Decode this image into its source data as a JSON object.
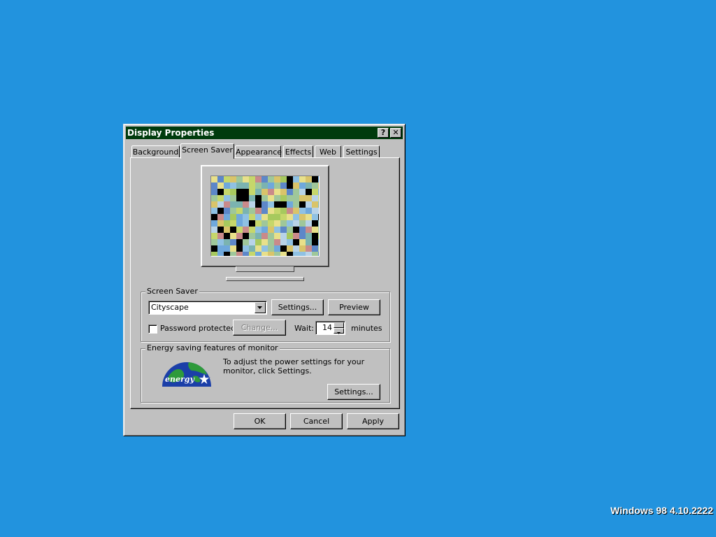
{
  "window": {
    "title": "Display Properties",
    "help_label": "?",
    "close_label": "✕"
  },
  "tabs": [
    {
      "label": "Background"
    },
    {
      "label": "Screen Saver",
      "active": true
    },
    {
      "label": "Appearance"
    },
    {
      "label": "Effects"
    },
    {
      "label": "Web"
    },
    {
      "label": "Settings"
    }
  ],
  "screen_saver": {
    "group_label": "Screen Saver",
    "selected": "Cityscape",
    "settings_label": "Settings...",
    "preview_label": "Preview",
    "password_label": "Password protected",
    "password_checked": false,
    "change_label": "Change...",
    "wait_label": "Wait:",
    "wait_value": "14",
    "minutes_label": "minutes"
  },
  "energy": {
    "group_label": "Energy saving features of monitor",
    "description": "To adjust the power settings for your monitor, click Settings.",
    "settings_label": "Settings...",
    "logo_text": "energy"
  },
  "footer": {
    "ok_label": "OK",
    "cancel_label": "Cancel",
    "apply_label": "Apply"
  },
  "desktop": {
    "version_text": "Windows 98 4.10.2222"
  },
  "colors": {
    "desktop": "#2293de",
    "titlebar": "#003b0d",
    "face": "#c0c0c0"
  },
  "icons": {
    "help": "question-mark-icon",
    "close": "close-icon",
    "dropdown": "chevron-down-icon"
  }
}
